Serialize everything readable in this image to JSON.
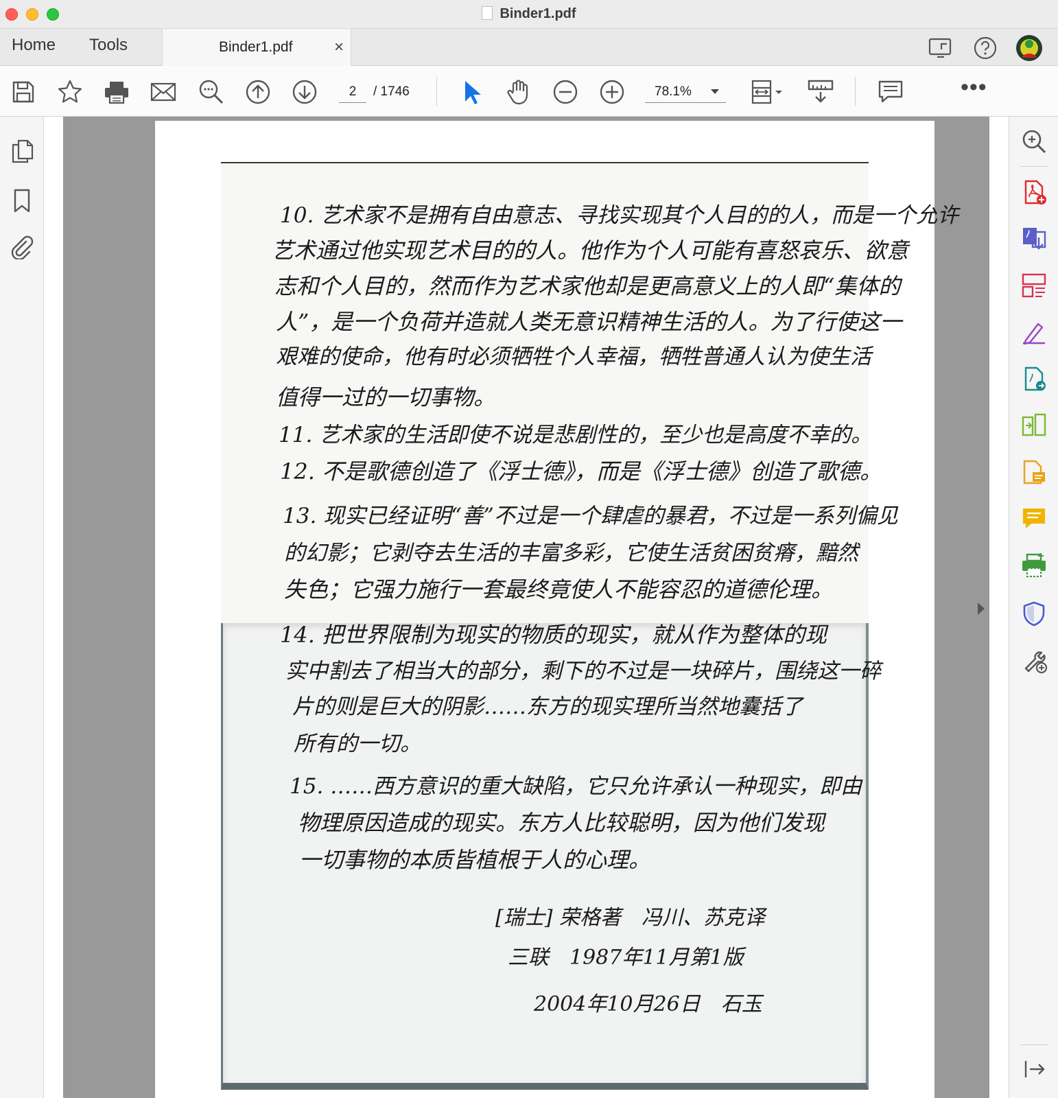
{
  "window": {
    "title": "Binder1.pdf"
  },
  "tabs": {
    "home": "Home",
    "tools": "Tools",
    "document": "Binder1.pdf",
    "close": "×"
  },
  "toolbar": {
    "current_page": "2",
    "total_pages": "/ 1746",
    "zoom": "78.1%",
    "more": "•••"
  },
  "document": {
    "lines": [
      "10. 艺术家不是拥有自由意志、寻找实现其个人目的的人，而是一个允许",
      "艺术通过他实现艺术目的的人。他作为个人可能有喜怒哀乐、欲意",
      "志和个人目的，然而作为艺术家他却是更高意义上的人即“集体的",
      "人”，是一个负荷并造就人类无意识精神生活的人。为了行使这一",
      "艰难的使命，他有时必须牺牲个人幸福，牺牲普通人认为使生活",
      "值得一过的一切事物。",
      "11. 艺术家的生活即使不说是悲剧性的，至少也是高度不幸的。",
      "12. 不是歌德创造了《浮士德》，而是《浮士德》创造了歌德。",
      "13. 现实已经证明“善”不过是一个肆虐的暴君，不过是一系列偏见",
      "的幻影；它剥夺去生活的丰富多彩，它使生活贫困贫瘠，黯然",
      "失色；它强力施行一套最终竟使人不能容忍的道德伦理。",
      "14. 把世界限制为现实的物质的现实，就从作为整体的现",
      "实中割去了相当大的部分，剩下的不过是一块碎片，围绕这一碎",
      "片的则是巨大的阴影……东方的现实理所当然地囊括了",
      "所有的一切。",
      "15. ……西方意识的重大缺陷，它只允许承认一种现实，即由",
      "物理原因造成的现实。东方人比较聪明，因为他们发现",
      "一切事物的本质皆植根于人的心理。",
      "[瑞士] 荣格著　冯川、苏克译",
      "三联　1987年11月第1版",
      "2004年10月26日　石玉"
    ]
  },
  "icons": {
    "toolbar": [
      "save-icon",
      "star-icon",
      "print-icon",
      "mail-icon",
      "zoom-search-icon",
      "page-up-icon",
      "page-down-icon",
      "select-arrow-icon",
      "hand-icon",
      "zoom-out-icon",
      "zoom-in-icon",
      "fit-page-icon",
      "scroll-mode-icon",
      "comment-icon"
    ],
    "left_nav": [
      "pages-icon",
      "bookmark-icon",
      "attachment-icon"
    ],
    "right_tools": [
      "search-zoom-icon",
      "create-pdf-icon",
      "export-pdf-icon",
      "organize-pages-icon",
      "fill-sign-icon",
      "edit-pdf-icon",
      "compress-pdf-icon",
      "request-signature-icon",
      "comment-tool-icon",
      "print-production-icon",
      "protect-icon",
      "more-tools-icon",
      "collapse-pane-icon"
    ]
  },
  "colors": {
    "accent": "#1473e6",
    "page_bg": "#999999"
  }
}
